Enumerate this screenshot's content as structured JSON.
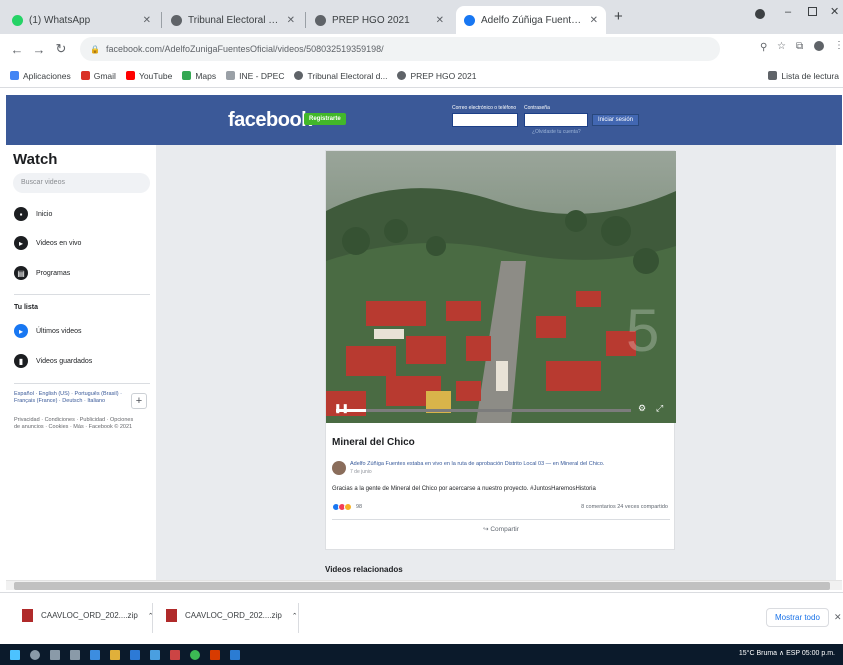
{
  "browser": {
    "tabs": [
      {
        "title": "(1) WhatsApp",
        "color": "#25d366"
      },
      {
        "title": "Tribunal Electoral del Poder Judi...",
        "color": "#5f6368"
      },
      {
        "title": "PREP HGO 2021",
        "color": "#5f6368"
      },
      {
        "title": "Adelfo Zúñiga Fuentes - Vi...",
        "color": "#1877f2"
      }
    ],
    "new_tab": "+",
    "url": "facebook.com/AdelfoZunigaFuentesOficial/videos/508032519359198/",
    "bookmarks": [
      "Aplicaciones",
      "Gmail",
      "YouTube",
      "Maps",
      "INE - DPEC",
      "Tribunal Electoral d...",
      "PREP HGO 2021"
    ],
    "reading_list": "Lista de lectura"
  },
  "facebook": {
    "logo": "facebook",
    "signup": "Registrarte",
    "email_label": "Correo electrónico o teléfono",
    "password_label": "Contraseña",
    "login": "Iniciar sesión",
    "forgot": "¿Olvidaste tu cuenta?"
  },
  "sidebar": {
    "title": "Watch",
    "search_placeholder": "Buscar videos",
    "items": [
      {
        "label": "Inicio"
      },
      {
        "label": "Videos en vivo"
      },
      {
        "label": "Programas"
      }
    ],
    "section": "Tu lista",
    "list_items": [
      {
        "label": "Últimos videos"
      },
      {
        "label": "Videos guardados"
      }
    ],
    "languages": "Español · English (US) · Português (Brasil) · Français (France) · Deutsch · Italiano",
    "privacy": "Privacidad · Condiciones · Publicidad · Opciones de anuncios · Cookies · Más · Facebook © 2021"
  },
  "post": {
    "title": "Mineral del Chico",
    "author": "Adelfo Zúñiga Fuentes estaba en vivo en la ruta de aprobación Distrito Local 03 — en Mineral del Chico.",
    "date": "7 de junio",
    "body": "Gracias a la gente de Mineral del Chico por acercarse a nuestro proyecto. #JuntosHaremosHistoria",
    "reactions_count": "98",
    "stats": "8 comentarios  24 veces compartido",
    "share": "Compartir"
  },
  "related": "Videos relacionados",
  "downloads": {
    "files": [
      "CAAVLOC_ORD_202....zip",
      "CAAVLOC_ORD_202....zip"
    ],
    "show_all": "Mostrar todo"
  },
  "taskbar": {
    "tray": "15°C Bruma  ∧  ESP  05:00 p.m."
  }
}
